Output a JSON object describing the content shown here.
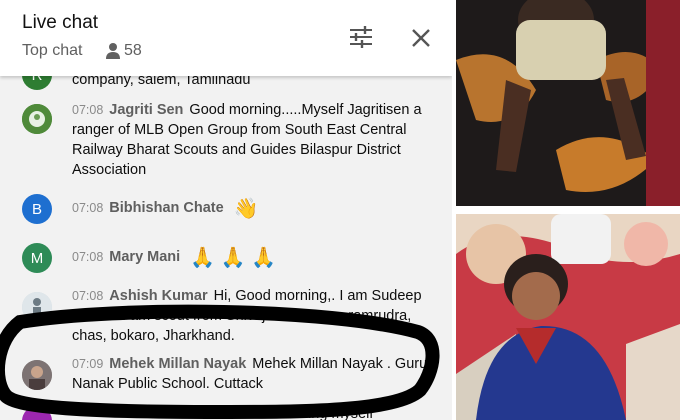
{
  "header": {
    "title": "Live chat",
    "mode": "Top chat",
    "viewers": "58",
    "icons": [
      "person-icon",
      "filter-icon",
      "close-icon"
    ]
  },
  "messages": [
    {
      "time": "",
      "author": "",
      "text": "company, salem, Tamilnadu",
      "avatar_letter": "R",
      "avatar_color": "#2e7d32"
    },
    {
      "time": "07:08",
      "author": "Jagriti Sen",
      "text": "Good morning.....Myself Jagritisen a ranger of MLB Open Group from South East Central Railway Bharat Scouts and Guides Bilaspur District Association",
      "avatar_letter": "",
      "avatar_color": "#4f8a3a"
    },
    {
      "time": "07:08",
      "author": "Bibhishan Chate",
      "text": "",
      "emoji": "👋",
      "avatar_letter": "B",
      "avatar_color": "#1e6fd0"
    },
    {
      "time": "07:08",
      "author": "Mary Mani",
      "text": "",
      "emoji": "🙏 🙏 🙏",
      "avatar_letter": "M",
      "avatar_color": "#2e8b57"
    },
    {
      "time": "07:08",
      "author": "Ashish Kumar",
      "text": "Hi, Good morning,. I am Sudeep Kumar. I am scout from Shivaji scout troop ramrudra, chas, bokaro, Jharkhand.",
      "avatar_letter": "",
      "avatar_color": "#cfd8dc"
    },
    {
      "time": "07:09",
      "author": "Mehek Millan Nayak",
      "text": "Mehek Millan Nayak . Guru Nanak Public School. Cuttack",
      "avatar_letter": "",
      "avatar_color": "#8d8d8d"
    },
    {
      "time": "",
      "author": "",
      "text": "ning myself",
      "avatar_letter": "",
      "avatar_color": "#9c27b0"
    }
  ],
  "colors": {
    "panel_bg": "#f2f2f2",
    "header_bg": "#ffffff",
    "annotation": "#000000"
  }
}
